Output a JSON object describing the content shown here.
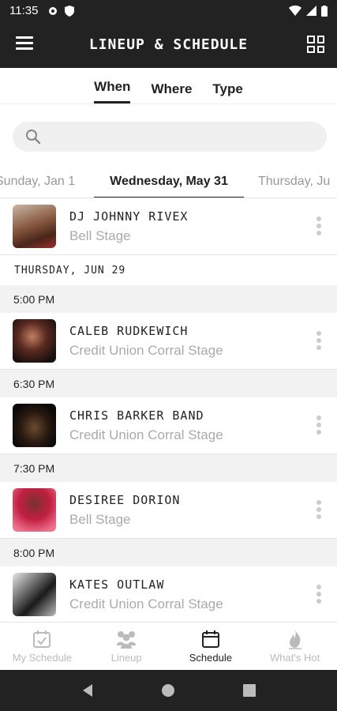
{
  "status": {
    "time": "11:35"
  },
  "header": {
    "title": "LINEUP & SCHEDULE"
  },
  "filters": {
    "tabs": [
      {
        "label": "When"
      },
      {
        "label": "Where"
      },
      {
        "label": "Type"
      }
    ]
  },
  "search": {
    "placeholder": ""
  },
  "dates": {
    "prev": "Sunday, Jan 1",
    "current": "Wednesday, May 31",
    "next": "Thursday, Ju"
  },
  "first_row": {
    "name": "DJ JOHNNY RIVEX",
    "stage": "Bell Stage"
  },
  "day_header": "THURSDAY, JUN 29",
  "slots": [
    {
      "time": "5:00 PM",
      "name": "CALEB RUDKEWICH",
      "stage": "Credit Union Corral Stage"
    },
    {
      "time": "6:30 PM",
      "name": "CHRIS BARKER BAND",
      "stage": "Credit Union Corral Stage"
    },
    {
      "time": "7:30 PM",
      "name": "DESIREE DORION",
      "stage": "Bell Stage"
    },
    {
      "time": "8:00 PM",
      "name": "KATES OUTLAW",
      "stage": "Credit Union Corral Stage"
    }
  ],
  "bottom_nav": {
    "items": [
      {
        "label": "My Schedule",
        "icon": "calendar-check-icon"
      },
      {
        "label": "Lineup",
        "icon": "people-icon"
      },
      {
        "label": "Schedule",
        "icon": "calendar-icon"
      },
      {
        "label": "What's Hot",
        "icon": "flame-icon"
      }
    ]
  },
  "colors": {
    "bar": "#222222",
    "muted": "#aaaaaa",
    "section": "#f2f2f3"
  }
}
